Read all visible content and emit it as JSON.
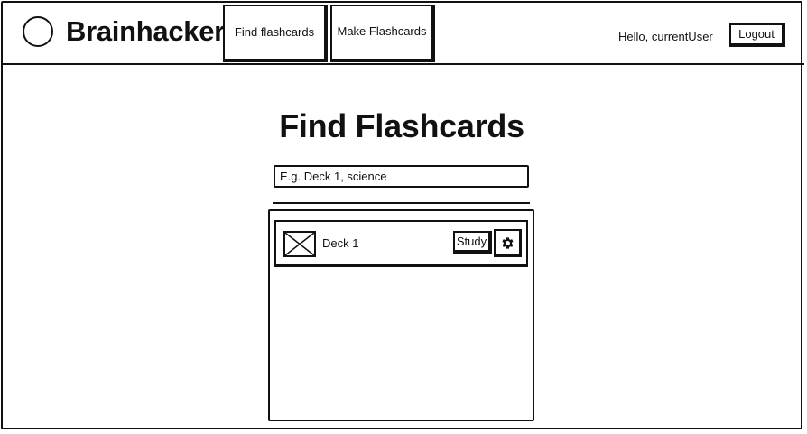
{
  "header": {
    "brand": "Brainhacker",
    "logo_icon": "circle-logo-icon",
    "nav": [
      {
        "label": "Find flashcards"
      },
      {
        "label": "Make Flashcards"
      }
    ],
    "greeting": "Hello, currentUser",
    "logout_label": "Logout"
  },
  "main": {
    "title": "Find Flashcards",
    "search": {
      "placeholder": "E.g. Deck 1, science",
      "value": ""
    },
    "decks": [
      {
        "name": "Deck 1",
        "thumbnail_icon": "image-placeholder-icon",
        "study_label": "Study",
        "settings_icon": "gear-icon"
      }
    ]
  }
}
